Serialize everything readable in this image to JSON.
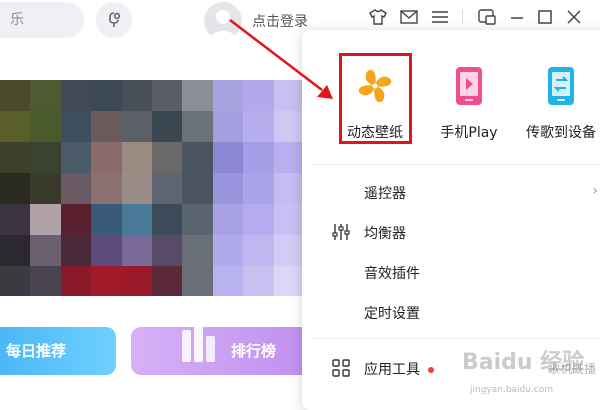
{
  "topbar": {
    "search_partial_text": "乐",
    "login_text": "点击登录",
    "icons": [
      "mic-icon",
      "avatar",
      "skin-icon",
      "mail-icon",
      "menu-icon",
      "mini-mode-icon",
      "minimize-icon",
      "maximize-icon",
      "close-icon"
    ]
  },
  "cards": {
    "daily": "每日推荐",
    "ranking": "排行榜"
  },
  "dropdown": {
    "tiles": [
      {
        "label": "动态壁纸",
        "icon": "pinwheel-icon",
        "color": "#f7a51c"
      },
      {
        "label": "手机Play",
        "icon": "phone-play-icon",
        "color": "#f04f8f"
      },
      {
        "label": "传歌到设备",
        "icon": "phone-transfer-icon",
        "color": "#1fb3e8"
      }
    ],
    "menu": [
      {
        "label": "遥控器",
        "has_arrow": true
      },
      {
        "label": "均衡器",
        "icon": "equalizer-icon"
      },
      {
        "label": "音效插件"
      },
      {
        "label": "定时设置"
      },
      {
        "label": "应用工具",
        "icon": "apps-grid-icon",
        "badge_dot": true
      }
    ],
    "menu_arrow": "›"
  },
  "watermark": {
    "main": "Baidu 经验",
    "sub": "jingyan.baidu.com",
    "side": "歌机既播"
  },
  "colors": {
    "highlight": "#e0141b",
    "accent_blue": "#48b6f5",
    "accent_purple": "#c090f0"
  }
}
